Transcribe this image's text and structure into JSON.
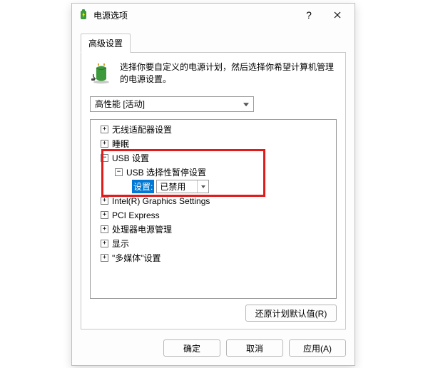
{
  "window": {
    "title": "电源选项"
  },
  "tab": {
    "label": "高级设置"
  },
  "info": {
    "text": "选择你要自定义的电源计划，然后选择你希望计算机管理的电源设置。"
  },
  "plan": {
    "selected": "高性能 [活动]"
  },
  "tree": {
    "items": [
      {
        "label": "无线适配器设置",
        "level": 0,
        "state": "collapsed"
      },
      {
        "label": "睡眠",
        "level": 0,
        "state": "collapsed"
      },
      {
        "label": "USB 设置",
        "level": 0,
        "state": "expanded"
      },
      {
        "label": "USB 选择性暂停设置",
        "level": 1,
        "state": "expanded"
      },
      {
        "label": "设置:",
        "level": 2,
        "state": "leaf",
        "selected": true,
        "value": "已禁用"
      },
      {
        "label": "Intel(R) Graphics Settings",
        "level": 0,
        "state": "collapsed"
      },
      {
        "label": "PCI Express",
        "level": 0,
        "state": "collapsed"
      },
      {
        "label": "处理器电源管理",
        "level": 0,
        "state": "collapsed"
      },
      {
        "label": "显示",
        "level": 0,
        "state": "collapsed"
      },
      {
        "label": "\"多媒体\"设置",
        "level": 0,
        "state": "collapsed"
      }
    ]
  },
  "buttons": {
    "restore": "还原计划默认值(R)",
    "ok": "确定",
    "cancel": "取消",
    "apply": "应用(A)"
  }
}
